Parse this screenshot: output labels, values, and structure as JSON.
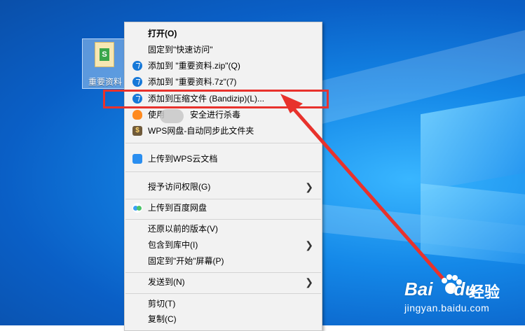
{
  "desktop": {
    "file_label": "重要资料",
    "file_icon_letter": "S"
  },
  "context_menu": {
    "items": [
      {
        "label": "打开(O)",
        "icon": "",
        "bold": true
      },
      {
        "label": "固定到\"快速访问\"",
        "icon": ""
      },
      {
        "label": "添加到 \"重要资料.zip\"(Q)",
        "icon": "bandizip-icon"
      },
      {
        "label": "添加到 \"重要资料.7z\"(7)",
        "icon": "bandizip-icon"
      },
      {
        "label": "添加到压缩文件 (Bandizip)(L)...",
        "icon": "bandizip-icon",
        "highlighted": true
      },
      {
        "label": "使用",
        "label_tail": "安全进行杀毒",
        "icon": "security-fire-icon"
      },
      {
        "label": "WPS网盘-自动同步此文件夹",
        "icon": "wps-disk-icon"
      },
      {
        "label": "上传到WPS云文档",
        "icon": "wps-cloud-icon"
      },
      {
        "label": "授予访问权限(G)",
        "icon": "",
        "submenu": true
      },
      {
        "label": "上传到百度网盘",
        "icon": "baidu-netdisk-icon"
      },
      {
        "label": "还原以前的版本(V)",
        "icon": ""
      },
      {
        "label": "包含到库中(I)",
        "icon": "",
        "submenu": true
      },
      {
        "label": "固定到\"开始\"屏幕(P)",
        "icon": ""
      },
      {
        "label": "发送到(N)",
        "icon": "",
        "submenu": true
      },
      {
        "label": "剪切(T)",
        "icon": ""
      },
      {
        "label": "复制(C)",
        "icon": ""
      }
    ]
  },
  "annotation": {
    "highlight_color": "#e8322c",
    "arrow_color": "#e8322c"
  },
  "watermark": {
    "brand": "Bai",
    "brand_tail": "du",
    "jingyan": "经验",
    "url": "jingyan.baidu.com"
  },
  "colors": {
    "desktop_blue": "#1488e8",
    "menu_bg": "#f2f2f2",
    "accent_red": "#e8322c"
  }
}
